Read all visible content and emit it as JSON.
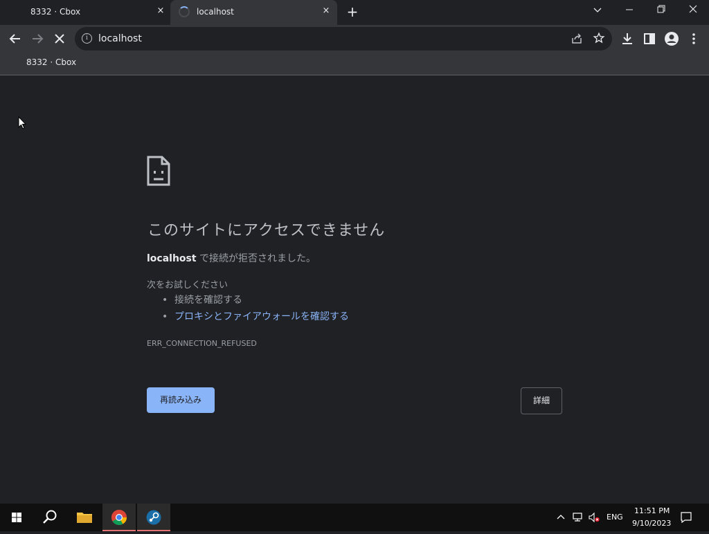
{
  "tabs": [
    {
      "title": "8332 · Cbox",
      "close": "×"
    },
    {
      "title": "localhost",
      "close": "×"
    }
  ],
  "window_controls": {
    "tab_search": "tab-search-chevron-icon",
    "minimize": "minimize-icon",
    "restore": "restore-icon",
    "close": "close-icon"
  },
  "toolbar": {
    "url": "localhost",
    "info_glyph": "i"
  },
  "bookmarks": [
    {
      "label": "8332 · Cbox"
    }
  ],
  "error_page": {
    "heading": "このサイトにアクセスできません",
    "host": "localhost",
    "message": "で接続が拒否されました。",
    "try_label": "次をお試しください",
    "suggestions": [
      {
        "text": "接続を確認する",
        "is_link": false
      },
      {
        "text": "プロキシとファイアウォールを確認する",
        "is_link": true
      }
    ],
    "error_code": "ERR_CONNECTION_REFUSED",
    "reload_label": "再読み込み",
    "details_label": "詳細"
  },
  "taskbar": {
    "language": "ENG",
    "time": "11:51 PM",
    "date": "9/10/2023",
    "apps": [
      "file-explorer-icon",
      "chrome-icon",
      "steam-icon"
    ]
  },
  "colors": {
    "accent": "#8ab4f8",
    "background": "#202124",
    "toolbar": "#35363a"
  }
}
